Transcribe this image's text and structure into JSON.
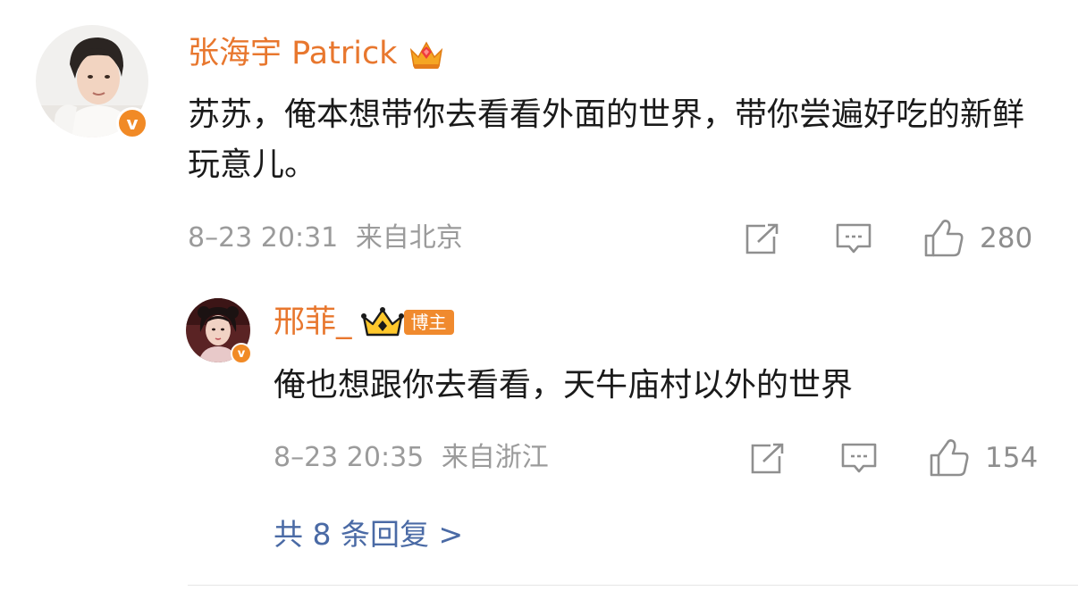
{
  "comment": {
    "username": "张海宇 Patrick",
    "text": "苏苏，俺本想带你去看看外面的世界，带你尝遍好吃的新鲜玩意儿。",
    "time": "8–23 20:31",
    "location": "来自北京",
    "like_count": "280",
    "badge_icon": "vip-crown-icon"
  },
  "reply": {
    "username": "邢菲_",
    "tag": "博主",
    "text": "俺也想跟你去看看，天牛庙村以外的世界",
    "time": "8–23 20:35",
    "location": "来自浙江",
    "like_count": "154"
  },
  "more_replies": "共 8 条回复 >",
  "colors": {
    "username": "#e8772e",
    "link": "#4a6aa5",
    "meta": "#9b9b9b",
    "verified_badge": "#f18a26"
  }
}
